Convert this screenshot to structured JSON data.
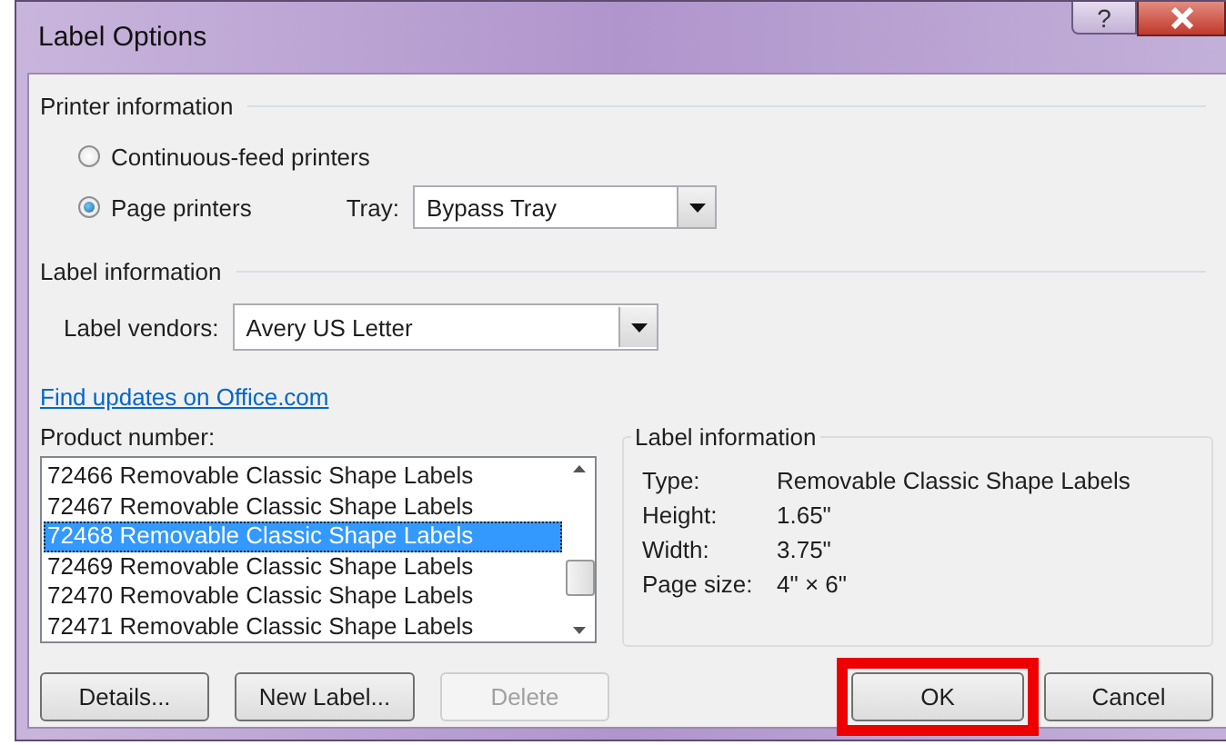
{
  "window": {
    "title": "Label Options",
    "help_button": "?"
  },
  "printer_information": {
    "heading": "Printer information",
    "printer_types": [
      {
        "label": "Continuous-feed printers",
        "selected": false
      },
      {
        "label": "Page printers",
        "selected": true
      }
    ],
    "tray": {
      "label": "Tray:",
      "value": "Bypass Tray"
    }
  },
  "label_information": {
    "heading": "Label information",
    "vendors": {
      "label": "Label vendors:",
      "value": "Avery US Letter"
    }
  },
  "link": "Find updates on Office.com",
  "product_number": {
    "label": "Product number:",
    "items": [
      {
        "text": "72466 Removable Classic Shape Labels",
        "selected": false
      },
      {
        "text": "72467 Removable Classic Shape Labels",
        "selected": false
      },
      {
        "text": "72468 Removable Classic Shape Labels",
        "selected": true
      },
      {
        "text": "72469 Removable Classic Shape Labels",
        "selected": false
      },
      {
        "text": "72470 Removable Classic Shape Labels",
        "selected": false
      },
      {
        "text": "72471 Removable Classic Shape Labels",
        "selected": false
      }
    ]
  },
  "details_panel": {
    "heading": "Label information",
    "rows": [
      {
        "label": "Type:",
        "value": "Removable Classic Shape Labels"
      },
      {
        "label": "Height:",
        "value": "1.65\""
      },
      {
        "label": "Width:",
        "value": "3.75\""
      },
      {
        "label": "Page size:",
        "value": "4\" × 6\""
      }
    ]
  },
  "buttons": [
    {
      "label": "Details...",
      "disabled": false,
      "highlighted": false
    },
    {
      "label": "New Label...",
      "disabled": false,
      "highlighted": false
    },
    {
      "label": "Delete",
      "disabled": true,
      "highlighted": false
    },
    {
      "label": "OK",
      "disabled": false,
      "highlighted": true
    },
    {
      "label": "Cancel",
      "disabled": false,
      "highlighted": false
    }
  ]
}
